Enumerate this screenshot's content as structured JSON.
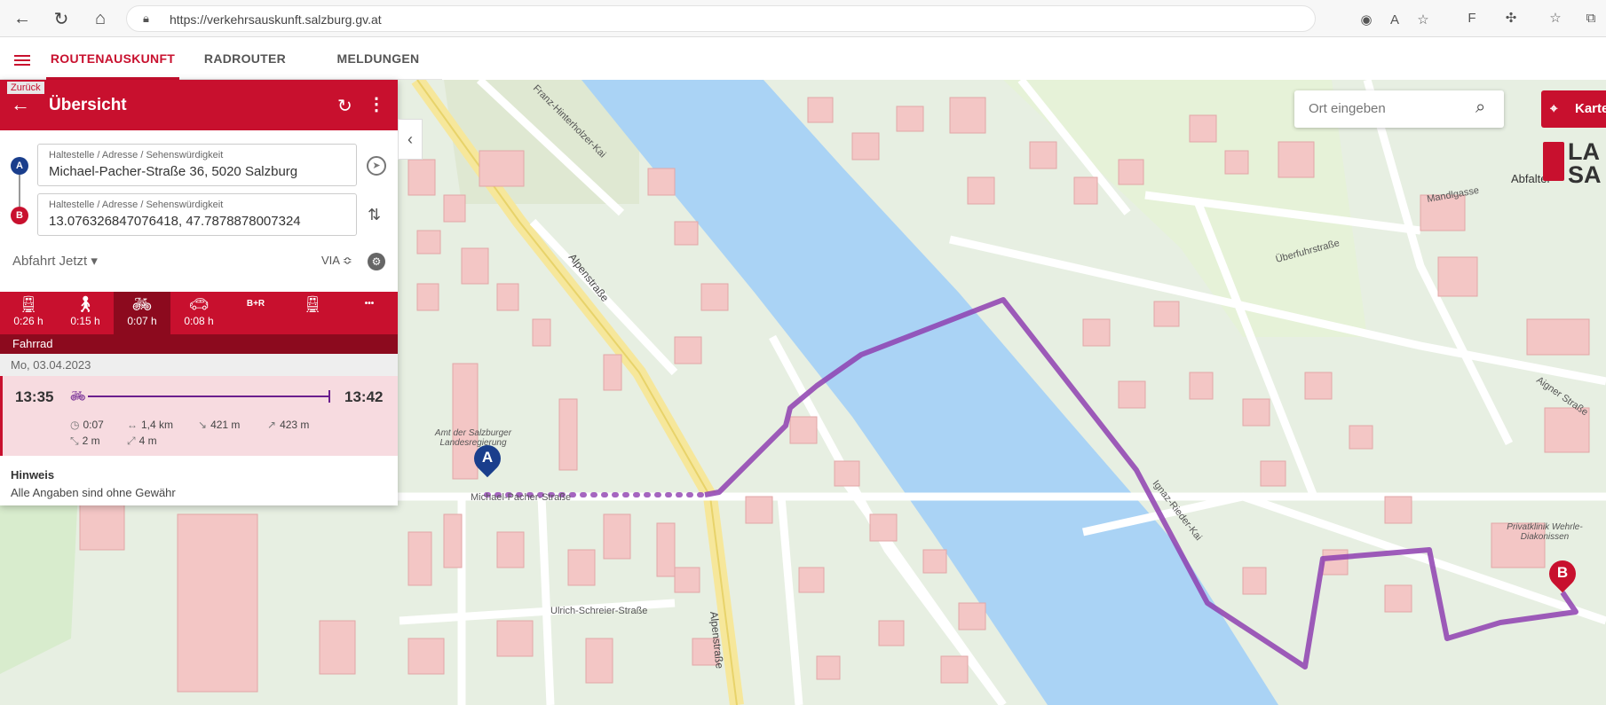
{
  "browser": {
    "url": "https://verkehrsauskunft.salzburg.gv.at"
  },
  "app_nav": {
    "tabs": [
      {
        "label": "ROUTENAUSKUNFT",
        "active": true
      },
      {
        "label": "RADROUTER",
        "active": false
      },
      {
        "label": "MELDUNGEN",
        "active": false
      }
    ]
  },
  "panel": {
    "back_label": "Zurück",
    "title": "Übersicht",
    "from": {
      "marker": "A",
      "label": "Haltestelle / Adresse / Sehenswürdigkeit",
      "value": "Michael-Pacher-Straße 36, 5020 Salzburg"
    },
    "to": {
      "marker": "B",
      "label": "Haltestelle / Adresse / Sehenswürdigkeit",
      "value": "13.076326847076418, 47.7878878007324"
    },
    "departure": "Abfahrt Jetzt ▾",
    "via": "VIA ≎",
    "modes": [
      {
        "icon": "train-icon",
        "time": "0:26 h"
      },
      {
        "icon": "walk-icon",
        "time": "0:15 h"
      },
      {
        "icon": "bike-icon",
        "time": "0:07 h",
        "active": true
      },
      {
        "icon": "car-icon",
        "time": "0:08 h"
      },
      {
        "icon": "park-ride",
        "text": "B+R"
      },
      {
        "icon": "train-bike-icon",
        "time": ""
      },
      {
        "icon": "more-icon",
        "text": "•••"
      }
    ],
    "mode_label": "Fahrrad",
    "date": "Mo, 03.04.2023",
    "trip": {
      "departure": "13:35",
      "arrival": "13:42",
      "duration": "0:07",
      "distance": "1,4 km",
      "descent": "421 m",
      "ascent": "423 m",
      "down": "2 m",
      "up": "4 m"
    },
    "hint_title": "Hinweis",
    "hint_text": "Alle Angaben sind ohne Gewähr"
  },
  "map": {
    "search_placeholder": "Ort eingeben",
    "map_button": "Karte",
    "logo_text": "LA\nSA",
    "pin_a": "A",
    "pin_b": "B",
    "labels": {
      "alpenstrasse": "Alpenstraße",
      "ignaz_rieder": "Ignaz-Rieder-Kai",
      "michael_pacher": "Michael-Pacher-Straße",
      "amt": "Amt der Salzburger Landesregierung",
      "privatklinik": "Privatklinik Wehrle-Diakonissen",
      "ueberfuhr": "Überfuhrstraße",
      "mandlgasse": "Mandlgasse",
      "aigner": "Aigner Straße",
      "ulrich": "Ulrich-Schreier-Straße",
      "abfalter": "Abfalter",
      "franz_hinterholzer": "Franz-Hinterholzer-Kai"
    }
  },
  "colors": {
    "brand_red": "#c8102e",
    "dark_red": "#8c0a1e",
    "route_purple": "#8e3fb0",
    "river": "#aad3f5",
    "building": "#f2c3c3"
  }
}
